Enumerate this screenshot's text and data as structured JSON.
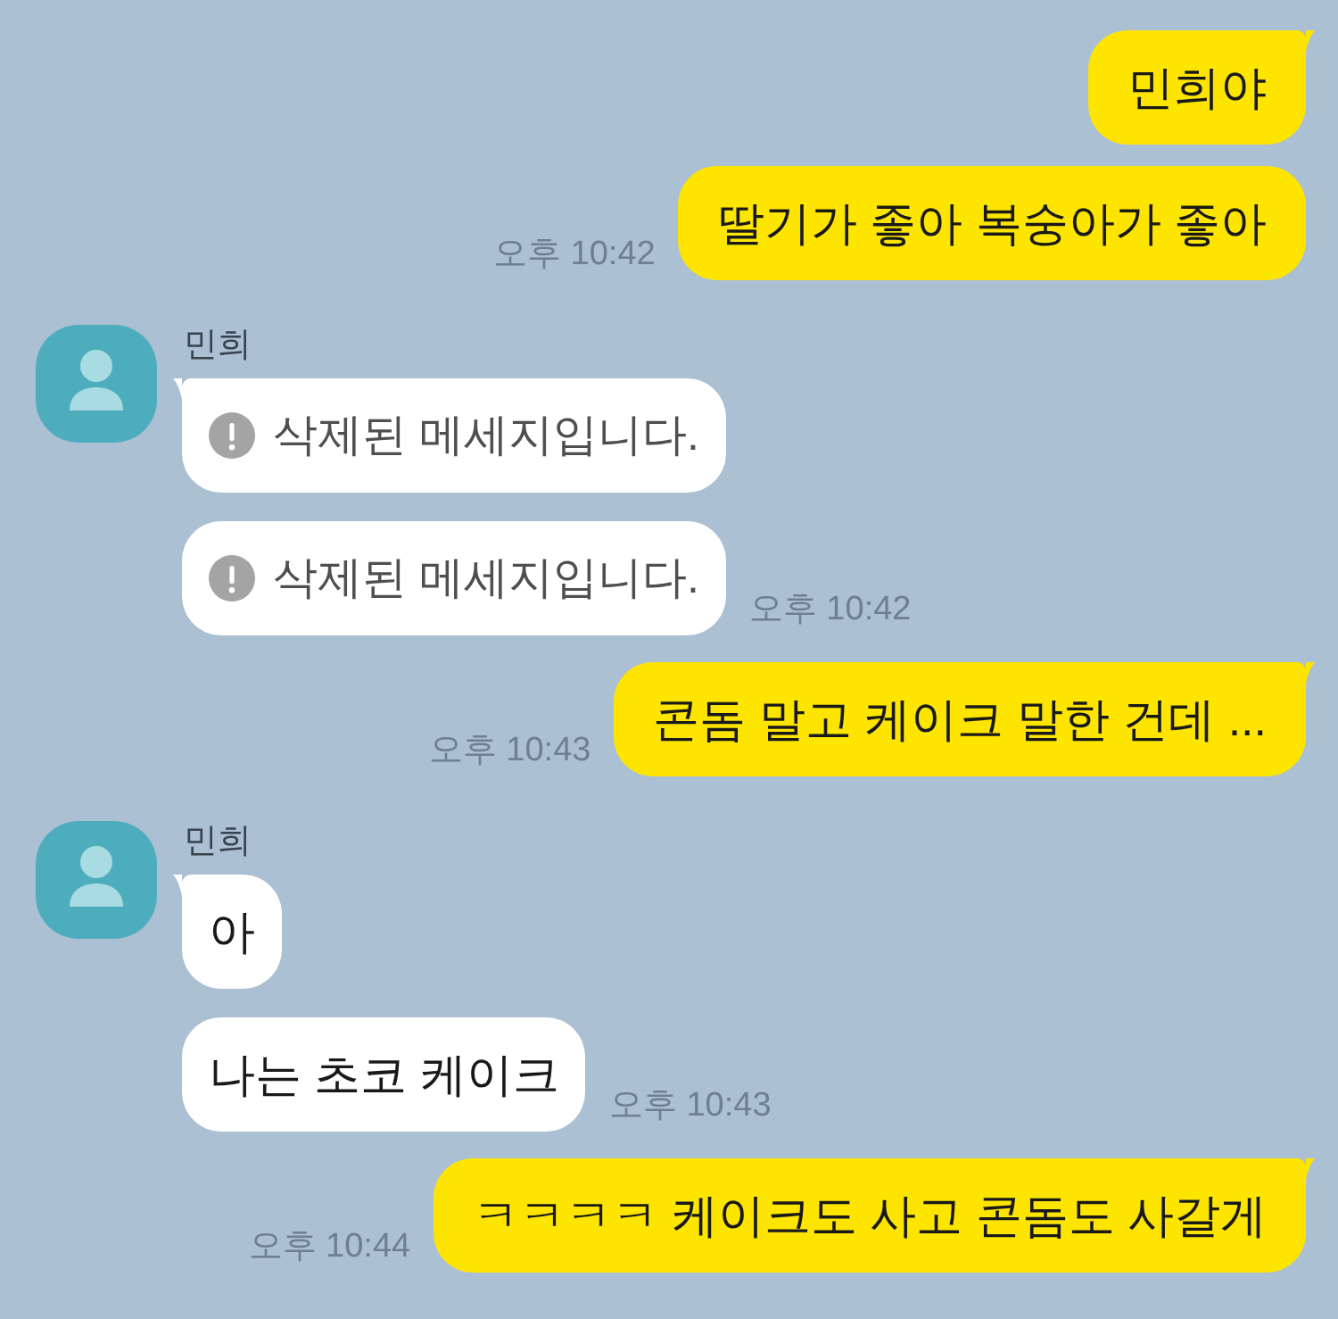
{
  "chat": [
    {
      "kind": "outgoing",
      "messages": [
        {
          "kind": "text",
          "text": "민희야"
        },
        {
          "kind": "text",
          "text": "딸기가 좋아 복숭아가 좋아",
          "time": "오후 10:42"
        }
      ]
    },
    {
      "kind": "incoming",
      "sender": "민희",
      "messages": [
        {
          "kind": "deleted",
          "text": "삭제된 메세지입니다."
        },
        {
          "kind": "deleted",
          "text": "삭제된 메세지입니다.",
          "time": "오후 10:42"
        }
      ]
    },
    {
      "kind": "outgoing",
      "messages": [
        {
          "kind": "text",
          "text": "콘돔 말고 케이크 말한 건데 ...",
          "time": "오후 10:43"
        }
      ]
    },
    {
      "kind": "incoming",
      "sender": "민희",
      "messages": [
        {
          "kind": "text",
          "text": "아"
        },
        {
          "kind": "text",
          "text": "나는 초코 케이크",
          "time": "오후 10:43"
        }
      ]
    },
    {
      "kind": "outgoing",
      "messages": [
        {
          "kind": "text",
          "text": "ㅋㅋㅋㅋ 케이크도 사고 콘돔도 사갈게",
          "time": "오후 10:44"
        }
      ]
    }
  ]
}
